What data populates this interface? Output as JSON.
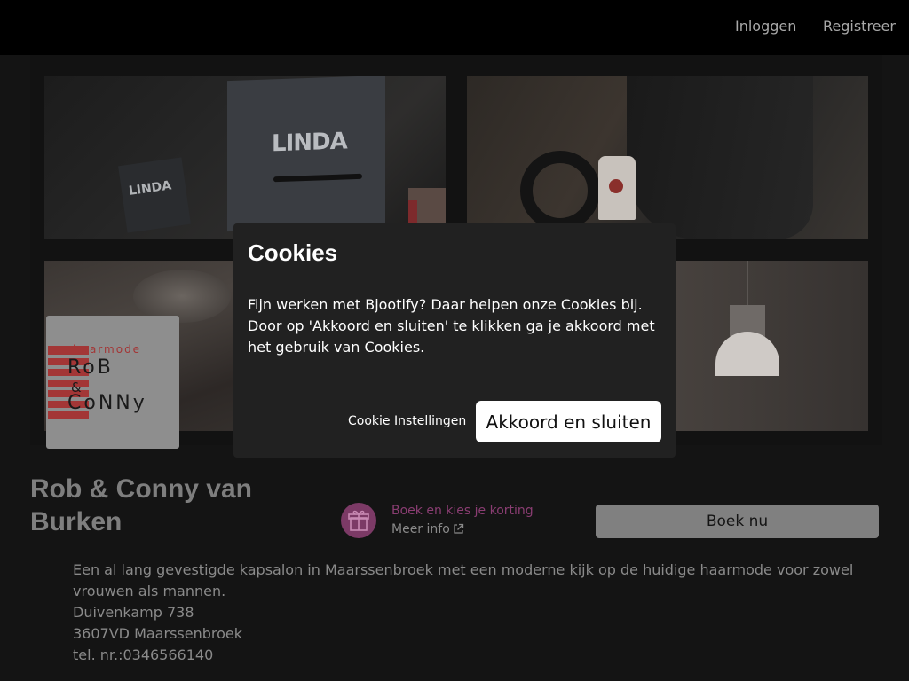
{
  "nav": {
    "login": "Inloggen",
    "register": "Registreer"
  },
  "gallery": {
    "brand_text": "LINDA",
    "brand_text_small": "LINDA"
  },
  "logo": {
    "line1": "haarmode",
    "line2": "RoB",
    "line3": "&",
    "line4": "CoNNy"
  },
  "salon": {
    "name": "Rob & Conny van Burken"
  },
  "promo": {
    "title": "Boek en kies je korting",
    "more_info": "Meer info"
  },
  "book_button": "Boek nu",
  "description": {
    "text": "Een al lang gevestigde kapsalon in Maarssenbroek met een moderne kijk op de huidige haarmode voor zowel vrouwen als mannen.",
    "street": "Duivenkamp 738",
    "postcode_city": "3607VD Maarssenbroek",
    "phone": "tel. nr.:0346566140"
  },
  "cookie_modal": {
    "title": "Cookies",
    "text": "Fijn werken met Bjootify? Daar helpen onze Cookies bij. Door op 'Akkoord en sluiten' te klikken ga je akkoord met het gebruik van Cookies.",
    "settings_label": "Cookie Instellingen",
    "accept_label": "Akkoord en sluiten"
  },
  "colors": {
    "topbar_bg": "#000000",
    "page_bg": "#141414",
    "modal_bg": "#212121",
    "accent_promo": "#8a3d72",
    "book_button_bg": "#808080"
  },
  "icons": {
    "gift": "gift-icon",
    "external_link": "external-link-icon"
  }
}
